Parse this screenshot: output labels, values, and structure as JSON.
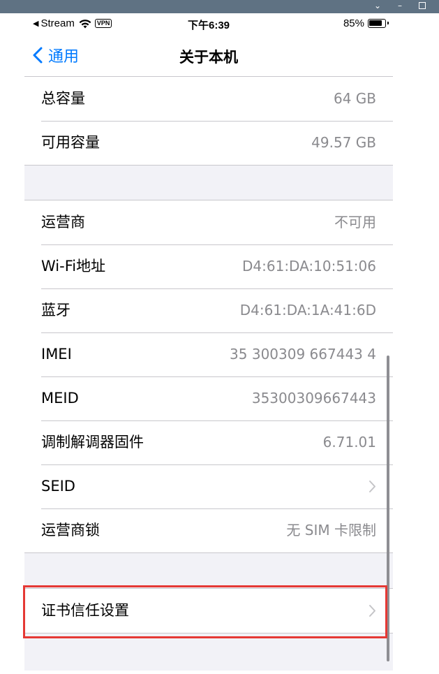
{
  "window": {
    "controls": {
      "chevron": "⌄",
      "minimize": "–"
    }
  },
  "status_bar": {
    "carrier": "Stream",
    "vpn": "VPN",
    "time": "下午6:39",
    "battery": "85%"
  },
  "nav": {
    "back_label": "通用",
    "title": "关于本机"
  },
  "groups": [
    {
      "rows": [
        {
          "label": "总容量",
          "value": "64 GB"
        },
        {
          "label": "可用容量",
          "value": "49.57 GB"
        }
      ]
    },
    {
      "rows": [
        {
          "label": "运营商",
          "value": "不可用"
        },
        {
          "label": "Wi-Fi地址",
          "value": "D4:61:DA:10:51:06"
        },
        {
          "label": "蓝牙",
          "value": "D4:61:DA:1A:41:6D"
        },
        {
          "label": "IMEI",
          "value": "35 300309 667443 4"
        },
        {
          "label": "MEID",
          "value": "35300309667443"
        },
        {
          "label": "调制解调器固件",
          "value": "6.71.01"
        },
        {
          "label": "SEID",
          "value": ""
        },
        {
          "label": "运营商锁",
          "value": "无 SIM 卡限制"
        }
      ]
    },
    {
      "rows": [
        {
          "label": "证书信任设置",
          "value": ""
        }
      ]
    }
  ],
  "colors": {
    "accent": "#007aff",
    "highlight": "#e53935",
    "window_bar": "#5f7283"
  }
}
